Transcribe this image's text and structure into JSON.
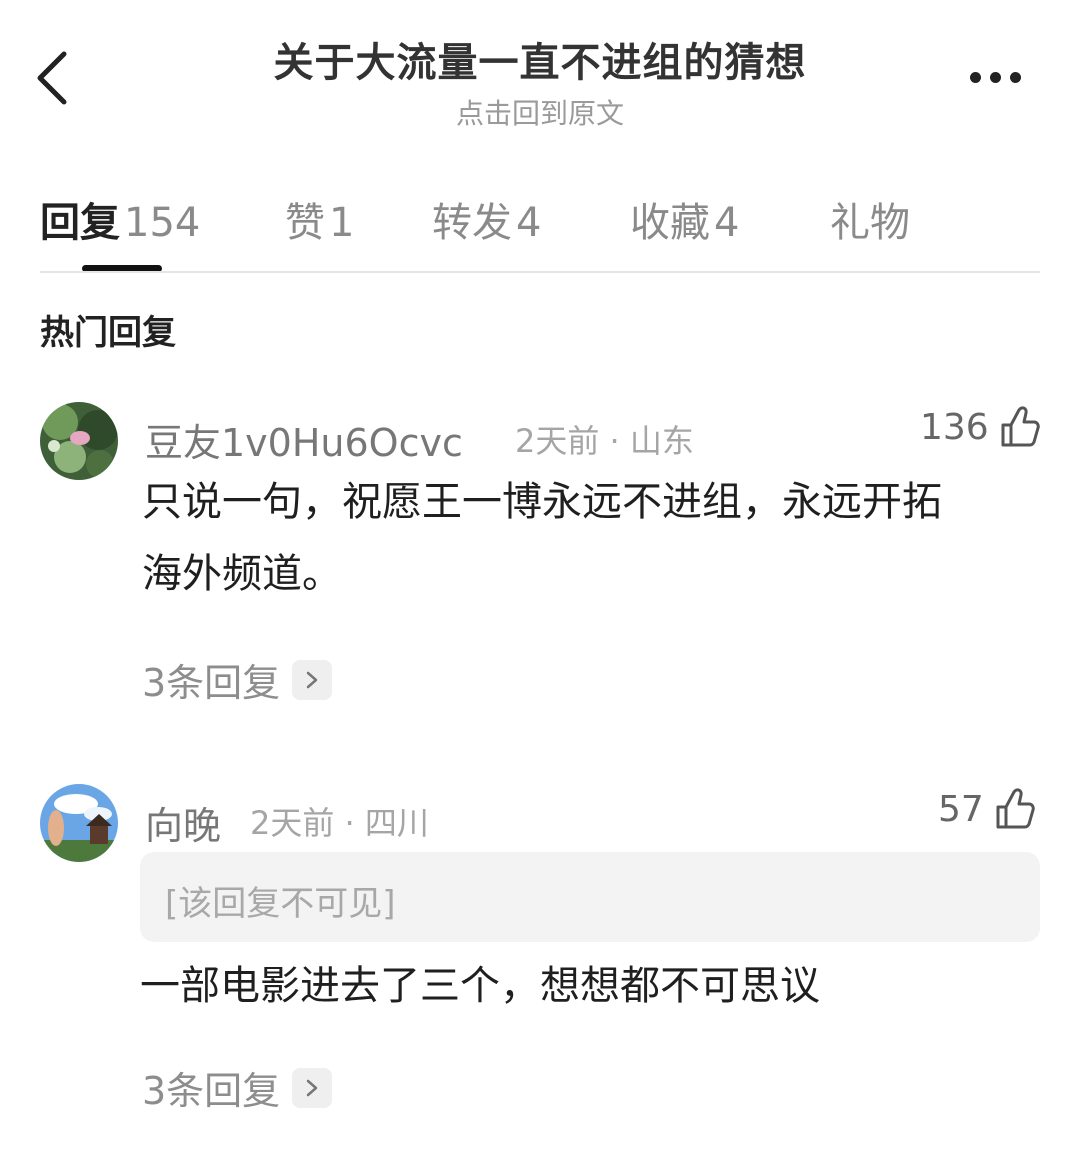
{
  "header": {
    "title": "关于大流量一直不进组的猜想",
    "subtitle": "点击回到原文"
  },
  "tabs": [
    {
      "label": "回复",
      "count": "154"
    },
    {
      "label": "赞",
      "count": "1"
    },
    {
      "label": "转发",
      "count": "4"
    },
    {
      "label": "收藏",
      "count": "4"
    },
    {
      "label": "礼物",
      "count": ""
    }
  ],
  "section_title": "热门回复",
  "comments": [
    {
      "user": "豆友1v0Hu6Ocvc",
      "time": "2天前",
      "location": "山东",
      "likes": "136",
      "content_line1": "只说一句，祝愿王一博永远不进组，永远开拓",
      "content_line2": "海外频道。",
      "replies": "3条回复"
    },
    {
      "user": "向晚",
      "time": "2天前",
      "location": "四川",
      "likes": "57",
      "hidden_reply": "[该回复不可见]",
      "content_line1": "一部电影进去了三个，想想都不可思议",
      "replies": "3条回复"
    }
  ],
  "icons": {
    "back": "chevron-left-icon",
    "more": "more-dots-icon",
    "like": "thumbs-up-icon",
    "arrow": "chevron-right-icon"
  }
}
